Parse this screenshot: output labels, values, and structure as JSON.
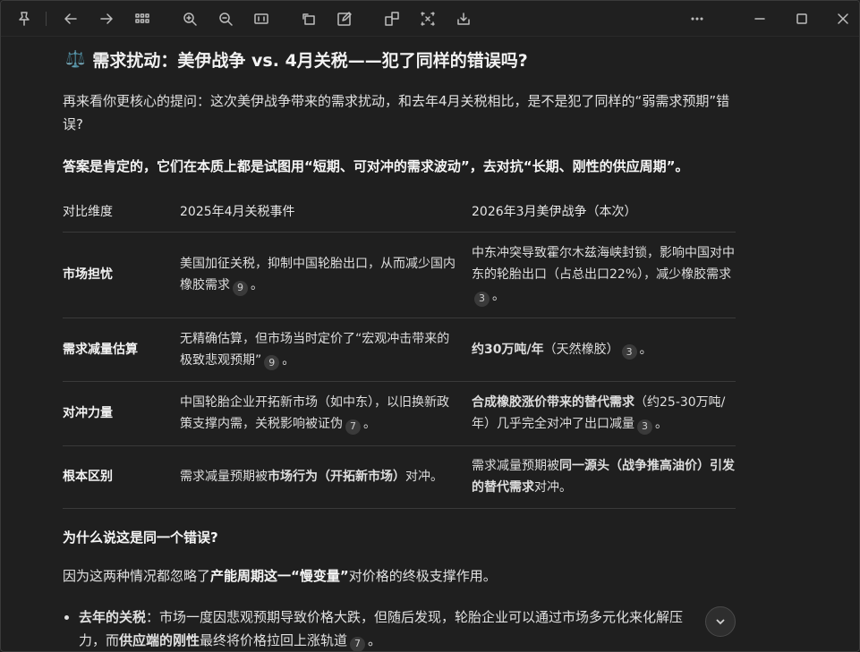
{
  "toolbar": {
    "icons": [
      "pin-icon",
      "back-icon",
      "forward-icon",
      "grid-icon",
      "zoom-in-icon",
      "zoom-out-icon",
      "fit-width-icon",
      "rotate-icon",
      "edit-icon",
      "extract-icon",
      "crop-icon",
      "download-icon",
      "more-icon",
      "minimize-icon",
      "maximize-icon",
      "close-icon"
    ]
  },
  "section": {
    "title": "需求扰动：美伊战争 vs. 4月关税——犯了同样的错误吗?",
    "intro": "再来看你更核心的提问：这次美伊战争带来的需求扰动，和去年4月关税相比，是不是犯了同样的“弱需求预期”错误?",
    "answer_pre": "答案是",
    "answer_bold": "肯定的，它们在本质上都是试图用“短期、可对冲的需求波动”，去对抗“长期、刚性的供应周期”。"
  },
  "table": {
    "headers": [
      "对比维度",
      "2025年4月关税事件",
      "2026年3月美伊战争（本次）"
    ],
    "rows": [
      {
        "dim": "市场担忧",
        "a": "美国加征关税，抑制中国轮胎出口，从而减少国内橡胶需求",
        "a_cite": "9",
        "b": "中东冲突导致霍尔木兹海峡封锁，影响中国对中东的轮胎出口（占总出口22%），减少橡胶需求",
        "b_cite": "3"
      },
      {
        "dim": "需求减量估算",
        "a": "无精确估算，但市场当时定价了“宏观冲击带来的极致悲观预期”",
        "a_cite": "9",
        "b_bold": "约30万吨/年",
        "b": "（天然橡胶）",
        "b_cite": "3"
      },
      {
        "dim": "对冲力量",
        "a": "中国轮胎企业开拓新市场（如中东），以旧换新政策支撑内需，关税影响被证伪",
        "a_cite": "7",
        "b_bold": "合成橡胶涨价带来的替代需求",
        "b": "（约25-30万吨/年）几乎完全对冲了出口减量",
        "b_cite": "3"
      },
      {
        "dim": "根本区别",
        "a_pre": "需求减量预期被",
        "a_bold": "市场行为（开拓新市场）",
        "a_post": "对冲。",
        "b_pre": "需求减量预期被",
        "b_bold": "同一源头（战争推高油价）引发的替代需求",
        "b_post": "对冲。"
      }
    ]
  },
  "why": {
    "title": "为什么说这是同一个错误?",
    "pre": "因为这两种情况都忽略了",
    "bold": "产能周期这一“慢变量”",
    "post": "对价格的终极支撑作用。"
  },
  "bullet": {
    "bold1": "去年的关税",
    "text1": "：市场一度因悲观预期导致价格大跌，但随后发现，轮胎企业可以通过市场多元化来化解压力，而",
    "bold2": "供应端的刚性",
    "text2": "最终将价格拉回上涨轨道",
    "cite": "7",
    "end": "。"
  }
}
